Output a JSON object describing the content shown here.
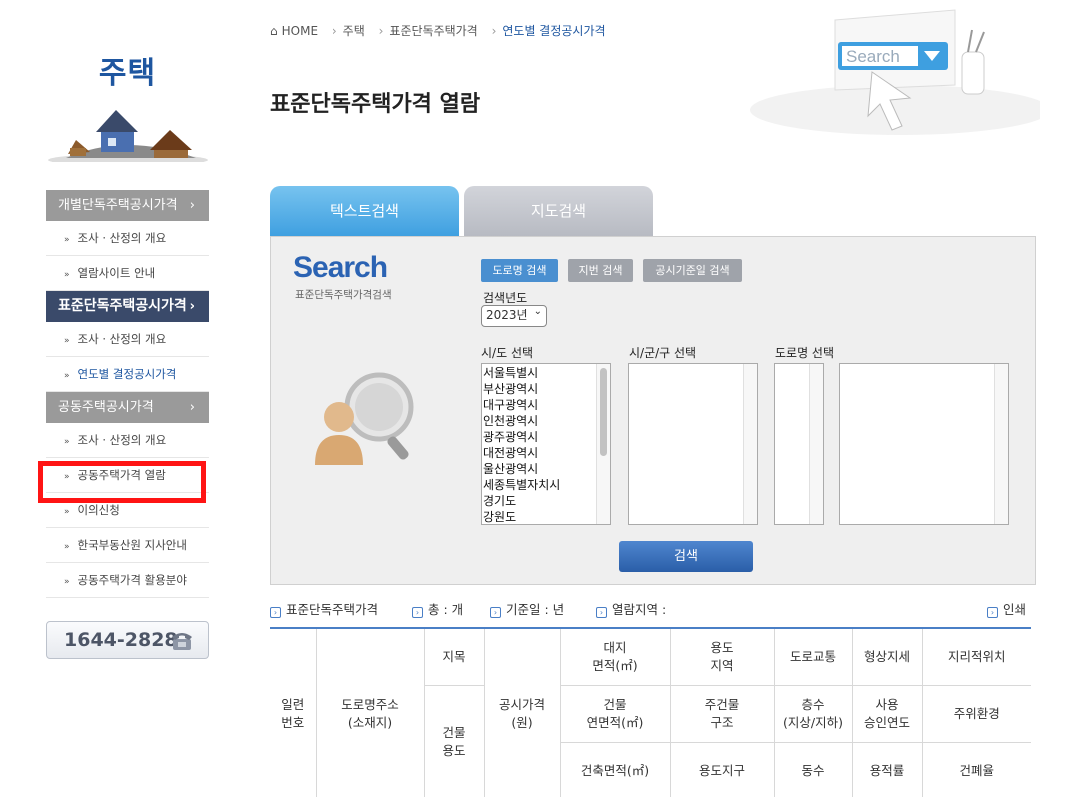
{
  "sidebar": {
    "title": "주택",
    "groups": [
      {
        "label": "개별단독주택공시가격",
        "chev": "›",
        "items": [
          "조사 · 산정의 개요",
          "열람사이트 안내"
        ]
      },
      {
        "label": "표준단독주택공시가격",
        "chev": "›",
        "items": [
          "조사 · 산정의 개요",
          "연도별 결정공시가격"
        ]
      },
      {
        "label": "공동주택공시가격",
        "chev": "›",
        "items": [
          "조사 · 산정의 개요",
          "공동주택가격 열람",
          "이의신청",
          "한국부동산원 지사안내",
          "공동주택가격 활용분야"
        ]
      }
    ],
    "bullet": "»",
    "phone": "1644-2828"
  },
  "breadcrumb": {
    "home": "HOME",
    "items": [
      "주택",
      "표준단독주택가격",
      "연도별 결정공시가격"
    ],
    "sep": "›"
  },
  "page_title": "표준단독주택가격 열람",
  "deco_text": "Search",
  "tabs": {
    "text": "텍스트검색",
    "map": "지도검색"
  },
  "search": {
    "logo": "Search",
    "subtitle": "표준단독주택가격검색",
    "mode_buttons": [
      "도로명 검색",
      "지번 검색",
      "공시기준일 검색"
    ],
    "year_label": "검색년도",
    "year_value": "2023년",
    "sido_label": "시/도 선택",
    "sigungu_label": "시/군/구 선택",
    "road_label": "도로명 선택",
    "sido_options": [
      "서울특별시",
      "부산광역시",
      "대구광역시",
      "인천광역시",
      "광주광역시",
      "대전광역시",
      "울산광역시",
      "세종특별자치시",
      "경기도",
      "강원도"
    ],
    "submit": "검색"
  },
  "summary": {
    "category": "표준단독주택가격",
    "total": "총 : 개",
    "base_date": "기준일 : 년",
    "region": "열람지역 :",
    "print": "인쇄"
  },
  "table": {
    "serial": "일련\n번호",
    "address": "도로명주소\n(소재지)",
    "jimok": "지목",
    "building_use": "건물\n용도",
    "price": "공시가격\n(원)",
    "row1": [
      "대지\n면적(㎡)",
      "용도\n지역",
      "도로교통",
      "형상지세",
      "지리적위치"
    ],
    "row2": [
      "건물\n연면적(㎡)",
      "주건물\n구조",
      "층수\n(지상/지하)",
      "사용\n승인연도",
      "주위환경"
    ],
    "row3": [
      "건축면적(㎡)",
      "용도지구",
      "동수",
      "용적률",
      "건폐율"
    ]
  }
}
